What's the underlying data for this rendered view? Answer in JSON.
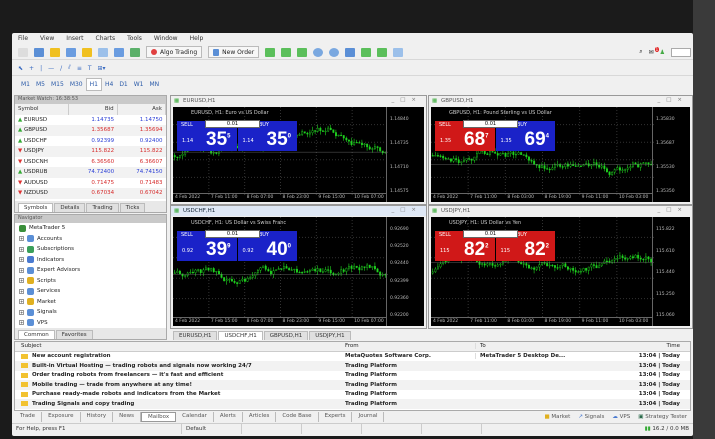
{
  "menu": [
    "File",
    "View",
    "Insert",
    "Charts",
    "Tools",
    "Window",
    "Help"
  ],
  "toolbar": {
    "algo_trading": "Algo Trading",
    "new_order": "New Order",
    "notification_count": "1"
  },
  "timeframes": [
    "M1",
    "M5",
    "M15",
    "M30",
    "H1",
    "H4",
    "D1",
    "W1",
    "MN"
  ],
  "selected_timeframe": "H1",
  "market_watch": {
    "title": "Market Watch: 16:38:53",
    "headers": [
      "Symbol",
      "Bid",
      "Ask"
    ],
    "rows": [
      {
        "symbol": "EURUSD",
        "bid": "1.14735",
        "ask": "1.14750",
        "dir": "up",
        "color": "#2b3fd6"
      },
      {
        "symbol": "GBPUSD",
        "bid": "1.35687",
        "ask": "1.35694",
        "dir": "up",
        "color": "#d62b2b"
      },
      {
        "symbol": "USDCHF",
        "bid": "0.92399",
        "ask": "0.92400",
        "dir": "up",
        "color": "#2b3fd6"
      },
      {
        "symbol": "USDJPY",
        "bid": "115.822",
        "ask": "115.822",
        "dir": "down",
        "color": "#d62b2b"
      },
      {
        "symbol": "USDCNH",
        "bid": "6.36560",
        "ask": "6.36607",
        "dir": "down",
        "color": "#d62b2b"
      },
      {
        "symbol": "USDRUB",
        "bid": "74.72400",
        "ask": "74.74150",
        "dir": "up",
        "color": "#2b3fd6"
      },
      {
        "symbol": "AUDUSD",
        "bid": "0.71475",
        "ask": "0.71483",
        "dir": "down",
        "color": "#d62b2b"
      },
      {
        "symbol": "NZDUSD",
        "bid": "0.67034",
        "ask": "0.67042",
        "dir": "down",
        "color": "#d62b2b"
      }
    ],
    "tabs": [
      "Symbols",
      "Details",
      "Trading",
      "Ticks"
    ]
  },
  "navigator": {
    "title": "Navigator",
    "root": "MetaTrader 5",
    "items": [
      "Accounts",
      "Subscriptions",
      "Indicators",
      "Expert Advisors",
      "Scripts",
      "Services",
      "Market",
      "Signals",
      "VPS"
    ],
    "tabs": [
      "Common",
      "Favorites"
    ]
  },
  "charts": [
    {
      "title": "EURUSD,H1",
      "desc": "EURUSD, H1:  Euro vs US Dollar",
      "lot": "0.01",
      "sell": "SELL",
      "buy": "BUY",
      "sell_pre": "1.14",
      "sell_big": "35",
      "sell_sup": "5",
      "buy_pre": "1.14",
      "buy_big": "35",
      "buy_sup": "0",
      "sell_color": "#1a22c8",
      "buy_color": "#1a22c8",
      "prices": [
        "1.14840",
        "1.14735",
        "1.14710",
        "1.14575"
      ],
      "times": [
        "4 Feb 2022",
        "7 Feb 11:00",
        "8 Feb 07:00",
        "8 Feb 23:00",
        "9 Feb 15:00",
        "10 Feb 07:00"
      ]
    },
    {
      "title": "GBPUSD,H1",
      "desc": "GBPUSD, H1:  Pound Sterling vs US Dollar",
      "lot": "0.01",
      "sell": "SELL",
      "buy": "BUY",
      "sell_pre": "1.35",
      "sell_big": "68",
      "sell_sup": "7",
      "buy_pre": "1.35",
      "buy_big": "69",
      "buy_sup": "4",
      "sell_color": "#d01818",
      "buy_color": "#1a22c8",
      "prices": [
        "1.35830",
        "1.35687",
        "1.35530",
        "1.35350"
      ],
      "times": [
        "4 Feb 2022",
        "7 Feb 11:00",
        "8 Feb 03:00",
        "8 Feb 19:00",
        "9 Feb 11:00",
        "10 Feb 03:00"
      ]
    },
    {
      "title": "USDCHF,H1",
      "desc": "USDCHF, H1:  US Dollar vs Swiss Franc",
      "lot": "0.01",
      "sell": "SELL",
      "buy": "BUY",
      "sell_pre": "0.92",
      "sell_big": "39",
      "sell_sup": "9",
      "buy_pre": "0.92",
      "buy_big": "40",
      "buy_sup": "0",
      "sell_color": "#1a22c8",
      "buy_color": "#1a22c8",
      "prices": [
        "0.92690",
        "0.92520",
        "0.92440",
        "0.92399",
        "0.92360",
        "0.92200"
      ],
      "times": [
        "4 Feb 2022",
        "7 Feb 15:00",
        "8 Feb 07:00",
        "8 Feb 23:00",
        "9 Feb 15:00",
        "10 Feb 07:00"
      ]
    },
    {
      "title": "USDJPY,H1",
      "desc": "USDJPY, H1:  US Dollar vs Yen",
      "lot": "0.01",
      "sell": "SELL",
      "buy": "BUY",
      "sell_pre": "115",
      "sell_big": "82",
      "sell_sup": "2",
      "buy_pre": "115",
      "buy_big": "82",
      "buy_sup": "2",
      "sell_color": "#d01818",
      "buy_color": "#d01818",
      "prices": [
        "115.822",
        "115.610",
        "115.440",
        "115.250",
        "115.060"
      ],
      "times": [
        "4 Feb 2022",
        "7 Feb 11:00",
        "8 Feb 03:00",
        "8 Feb 19:00",
        "9 Feb 11:00",
        "10 Feb 03:00"
      ]
    }
  ],
  "chart_tabs": [
    "EURUSD,H1",
    "USDCHF,H1",
    "GBPUSD,H1",
    "USDJPY,H1"
  ],
  "active_chart_tab": "USDCHF,H1",
  "mailbox": {
    "headers": [
      "Subject",
      "From",
      "To",
      "Time"
    ],
    "rows": [
      {
        "subject": "New account registration",
        "from": "MetaQuotes Software Corp.",
        "to": "MetaTrader 5 Desktop De...",
        "time": "13:04 | Today"
      },
      {
        "subject": "Built-in Virtual Hosting — trading robots and signals now working 24/7",
        "from": "Trading Platform",
        "to": "",
        "time": "13:04 | Today"
      },
      {
        "subject": "Order trading robots from freelancers — it's fast and efficient",
        "from": "Trading Platform",
        "to": "",
        "time": "13:04 | Today"
      },
      {
        "subject": "Mobile trading — trade from anywhere at any time!",
        "from": "Trading Platform",
        "to": "",
        "time": "13:04 | Today"
      },
      {
        "subject": "Purchase ready-made robots and indicators from the Market",
        "from": "Trading Platform",
        "to": "",
        "time": "13:04 | Today"
      },
      {
        "subject": "Trading Signals and copy trading",
        "from": "Trading Platform",
        "to": "",
        "time": "13:04 | Today"
      }
    ]
  },
  "toolbox_tabs": [
    "Trade",
    "Exposure",
    "History",
    "News",
    "Mailbox",
    "Calendar",
    "Alerts",
    "Articles",
    "Code Base",
    "Experts",
    "Journal"
  ],
  "active_toolbox_tab": "Mailbox",
  "toolbox_right": [
    "Market",
    "Signals",
    "VPS",
    "Strategy Tester"
  ],
  "status": {
    "help": "For Help, press F1",
    "profile": "Default",
    "traffic": "16.2 / 0.0 MB"
  }
}
